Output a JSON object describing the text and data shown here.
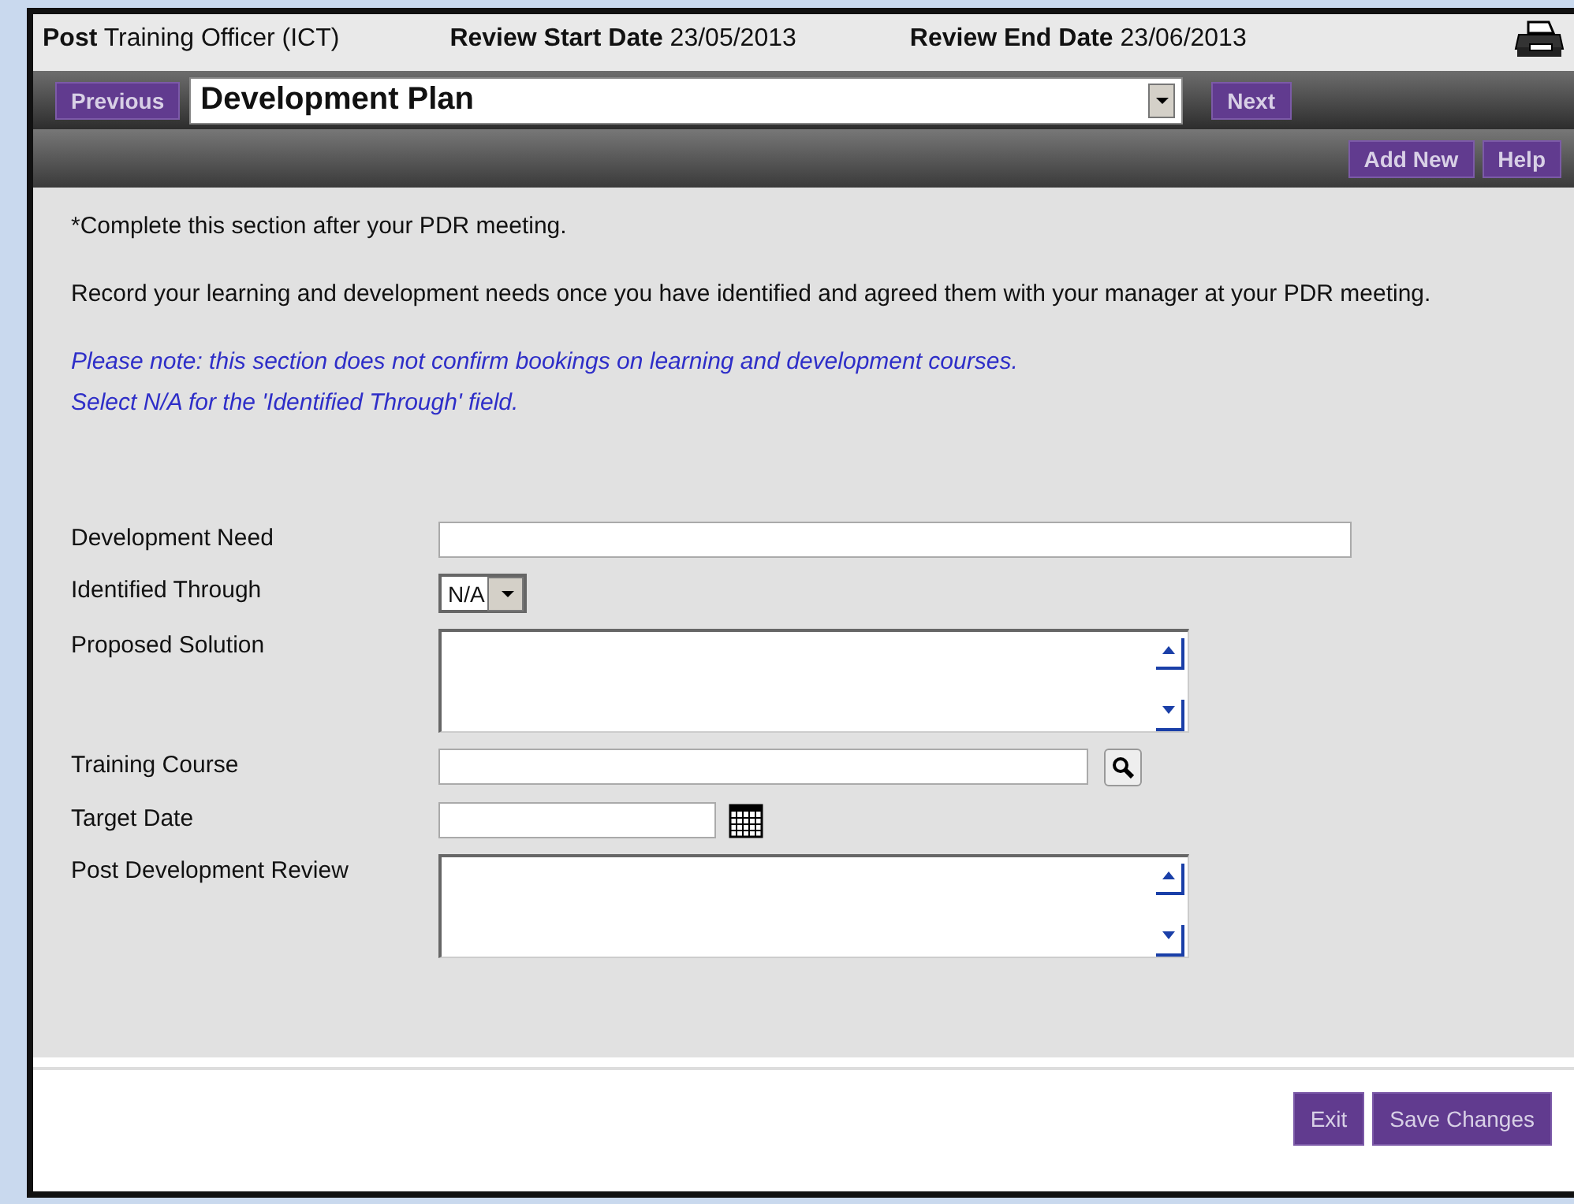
{
  "header": [
    {
      "label": "Post",
      "value": "Training Officer (ICT)"
    },
    {
      "label": "Review Start Date",
      "value": "23/05/2013"
    },
    {
      "label": "Review End Date",
      "value": "23/06/2013"
    }
  ],
  "nav": {
    "previous": "Previous",
    "section": "Development Plan",
    "next": "Next"
  },
  "toolbar": [
    "Add New",
    "Help"
  ],
  "instructions": [
    "*Complete this section after your PDR meeting.",
    "Record your learning and development needs once you have identified and agreed them with your manager at your PDR meeting."
  ],
  "notes": [
    "Please note: this section does not confirm bookings on learning and development courses.",
    "Select N/A for the 'Identified Through' field."
  ],
  "fields": [
    {
      "label": "Development Need",
      "kind": "text"
    },
    {
      "label": "Identified Through",
      "kind": "select",
      "value": "N/A"
    },
    {
      "label": "Proposed Solution",
      "kind": "textarea"
    },
    {
      "label": "Training Course",
      "kind": "lookup"
    },
    {
      "label": "Target Date",
      "kind": "date"
    },
    {
      "label": "Post Development Review",
      "kind": "textarea"
    }
  ],
  "footer": [
    "Exit",
    "Save Changes"
  ]
}
